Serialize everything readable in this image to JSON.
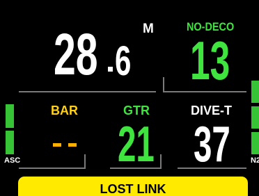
{
  "depth": {
    "whole": "28",
    "decimal": "6",
    "unit": "M"
  },
  "no_deco": {
    "label": "NO-DECO",
    "value": "13"
  },
  "bar": {
    "label": "BAR",
    "value": "--"
  },
  "gtr": {
    "label": "GTR",
    "value": "21"
  },
  "dive_time": {
    "label": "DIVE-T",
    "value": "37"
  },
  "gauges": {
    "ascent_label": "ASC",
    "n2_label": "N2"
  },
  "alert": {
    "text": "LOST LINK"
  },
  "colors": {
    "background": "#000000",
    "primary_text": "#ffffff",
    "safe_green": "#3fe43f",
    "bar_yellow": "#ffd21a",
    "dash_amber": "#ffb000",
    "alert_yellow": "#ffea00",
    "separator_gray": "#7a7a7a",
    "gauge_green": "#36c436"
  }
}
